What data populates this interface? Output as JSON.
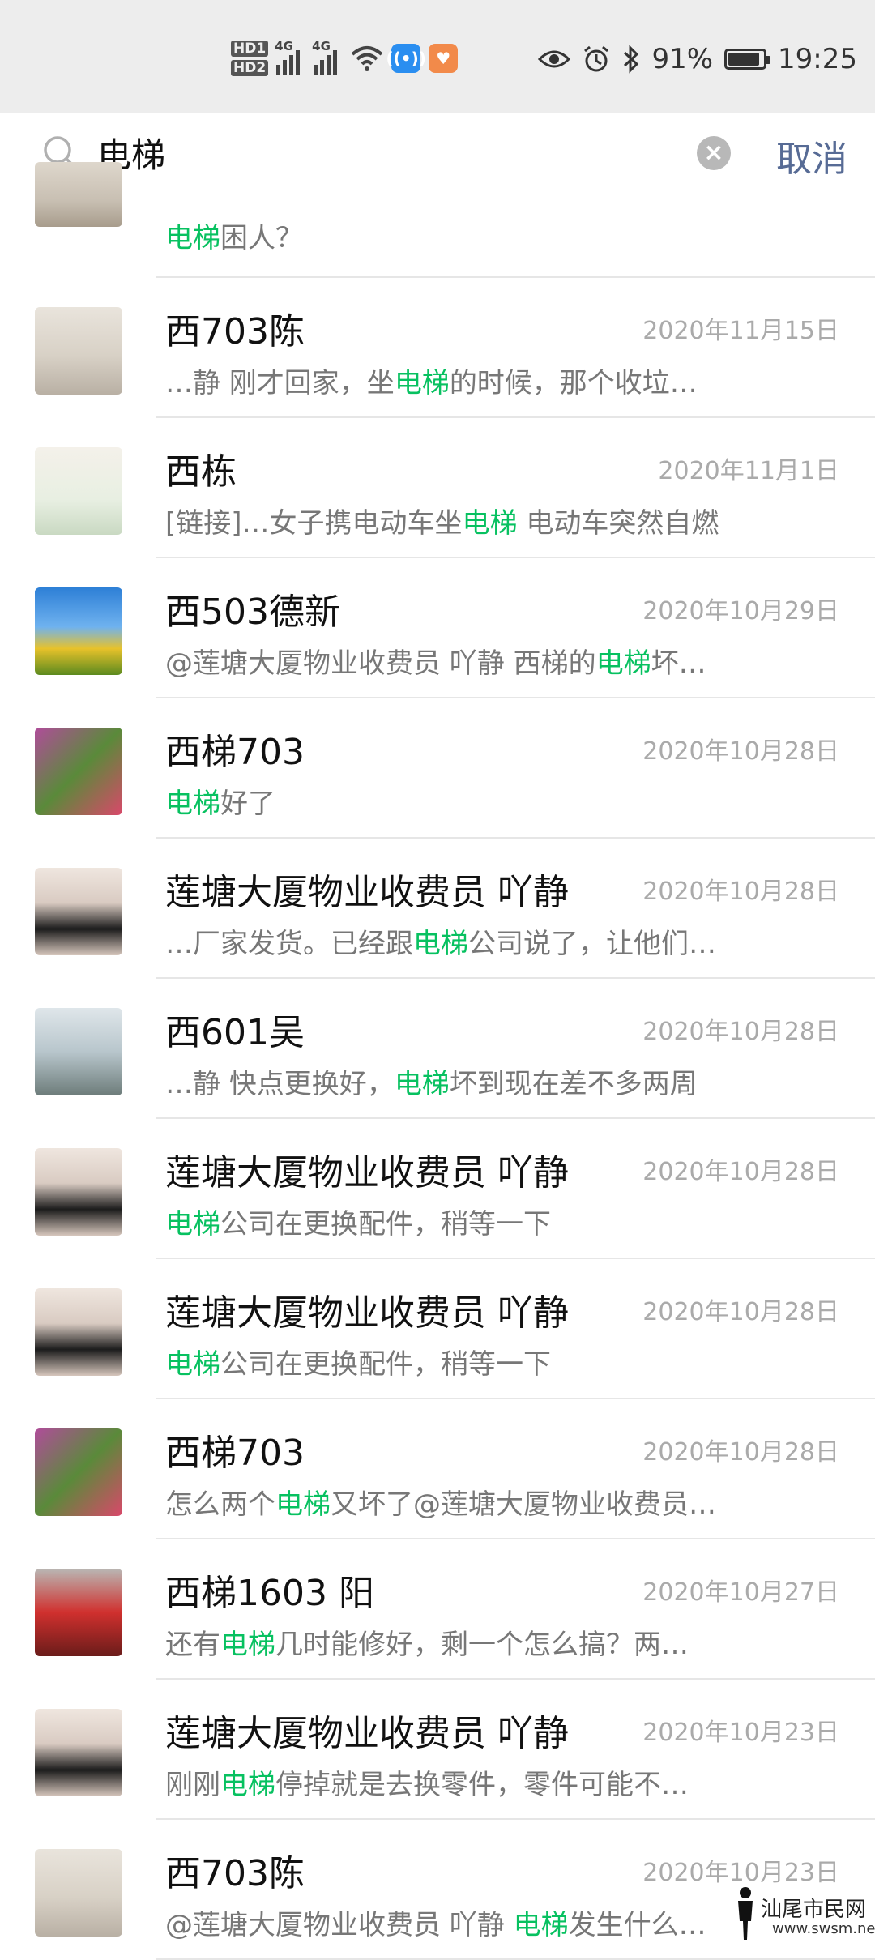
{
  "status_bar": {
    "hd1": "HD1",
    "hd2": "HD2",
    "net1": "4G",
    "net2": "4G",
    "battery_pct": "91%",
    "time": "19:25",
    "battery_level": 0.91
  },
  "search": {
    "query": "电梯",
    "cancel_label": "取消"
  },
  "highlight_color": "#07c160",
  "results": {
    "partial": {
      "pre": "",
      "hl": "电梯",
      "post": "困人？"
    },
    "items": [
      {
        "title": "西703陈",
        "date": "2020年11月15日",
        "pre": "…静 刚才回家，坐",
        "hl": "电梯",
        "post": "的时候，那个收垃…",
        "avatar_icon": "person-avatar-icon"
      },
      {
        "title": "西栋",
        "date": "2020年11月1日",
        "pre": "[链接]…女子携电动车坐",
        "hl": "电梯",
        "post": " 电动车突然自燃",
        "avatar_icon": "family-avatar-icon"
      },
      {
        "title": "西503德新",
        "date": "2020年10月29日",
        "pre": "@莲塘大厦物业收费员  吖静 西梯的",
        "hl": "电梯",
        "post": "坏…",
        "avatar_icon": "sunflower-avatar-icon"
      },
      {
        "title": "西梯703",
        "date": "2020年10月28日",
        "pre": "",
        "hl": "电梯",
        "post": "好了",
        "avatar_icon": "flowers-avatar-icon"
      },
      {
        "title": "莲塘大厦物业收费员  吖静",
        "date": "2020年10月28日",
        "pre": "…厂家发货。已经跟",
        "hl": "电梯",
        "post": "公司说了，让他们…",
        "avatar_icon": "woman-avatar-icon"
      },
      {
        "title": "西601吴",
        "date": "2020年10月28日",
        "pre": "…静 快点更换好，",
        "hl": "电梯",
        "post": "坏到现在差不多两周",
        "avatar_icon": "beach-avatar-icon"
      },
      {
        "title": "莲塘大厦物业收费员  吖静",
        "date": "2020年10月28日",
        "pre": "",
        "hl": "电梯",
        "post": "公司在更换配件，稍等一下",
        "avatar_icon": "woman-avatar-icon"
      },
      {
        "title": "莲塘大厦物业收费员  吖静",
        "date": "2020年10月28日",
        "pre": "",
        "hl": "电梯",
        "post": "公司在更换配件，稍等一下",
        "avatar_icon": "woman-avatar-icon"
      },
      {
        "title": "西梯703",
        "date": "2020年10月28日",
        "pre": "怎么两个",
        "hl": "电梯",
        "post": "又坏了@莲塘大厦物业收费员…",
        "avatar_icon": "flowers-avatar-icon"
      },
      {
        "title": "西梯1603 阳",
        "date": "2020年10月27日",
        "pre": "还有",
        "hl": "电梯",
        "post": "几时能修好，剩一个怎么搞？两…",
        "avatar_icon": "car-avatar-icon"
      },
      {
        "title": "莲塘大厦物业收费员  吖静",
        "date": "2020年10月23日",
        "pre": "刚刚",
        "hl": "电梯",
        "post": "停掉就是去换零件，零件可能不…",
        "avatar_icon": "woman-avatar-icon"
      },
      {
        "title": "西703陈",
        "date": "2020年10月23日",
        "pre": "@莲塘大厦物业收费员  吖静 ",
        "hl": "电梯",
        "post": "发生什么…",
        "avatar_icon": "person-avatar-icon"
      }
    ]
  },
  "watermark": {
    "text": "汕尾市民网",
    "url": "www.swsm.net"
  }
}
